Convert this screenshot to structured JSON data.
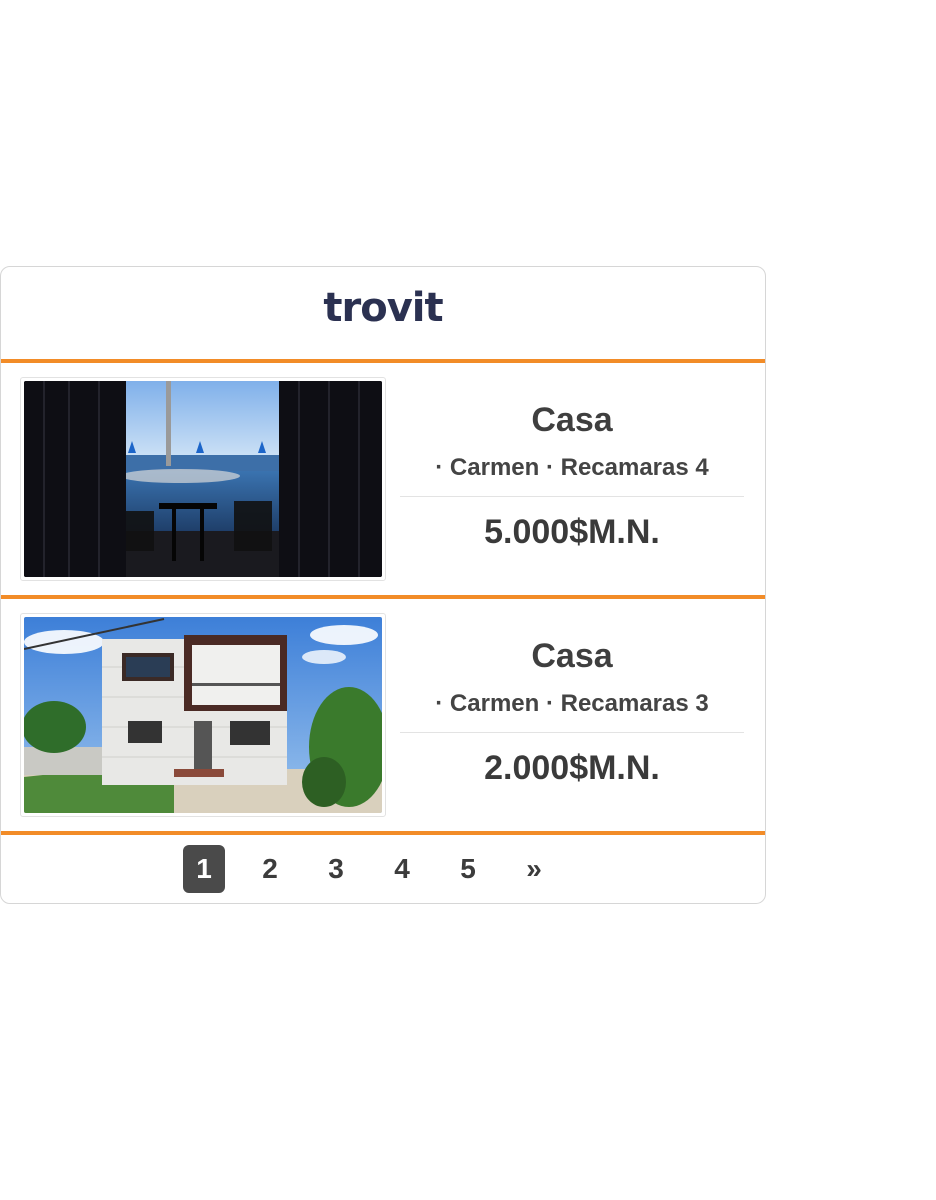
{
  "brand": {
    "logo_text": "trovit",
    "accent_color": "#f28c28",
    "logo_color": "#2b3151"
  },
  "listings": [
    {
      "title": "Casa",
      "subtitle": "· Carmen · Recamaras 4",
      "price": "5.000$M.N.",
      "image_icon": "pool-terrace-photo"
    },
    {
      "title": "Casa",
      "subtitle": "· Carmen · Recamaras 3",
      "price": "2.000$M.N.",
      "image_icon": "house-exterior-photo"
    }
  ],
  "pagination": {
    "pages": [
      "1",
      "2",
      "3",
      "4",
      "5"
    ],
    "current": "1",
    "next_label": "»"
  }
}
